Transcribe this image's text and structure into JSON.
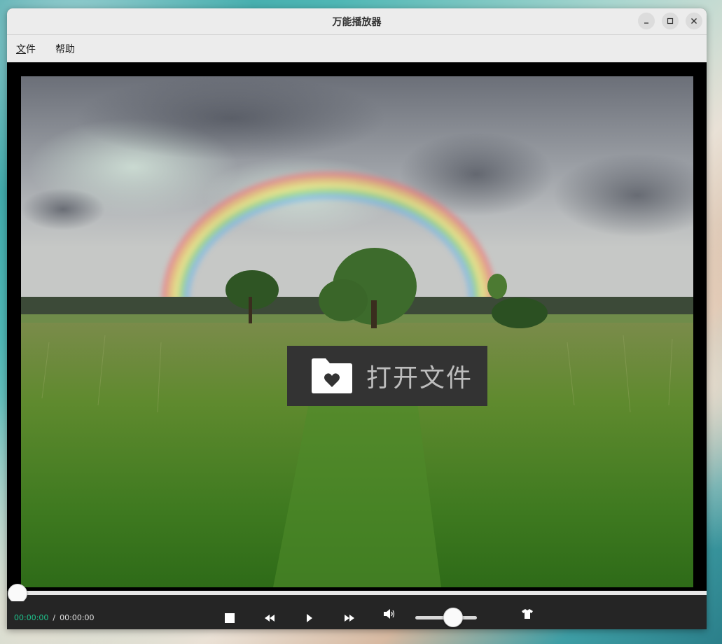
{
  "window": {
    "title": "万能播放器"
  },
  "menubar": {
    "items": [
      {
        "label": "文件",
        "mnemonic": "文"
      },
      {
        "label": "帮助"
      }
    ]
  },
  "video": {
    "open_file_label": "打开文件",
    "open_file_icon": "folder-heart-icon"
  },
  "playback": {
    "current_time": "00:00:00",
    "separator": "/",
    "total_time": "00:00:00",
    "progress": 0,
    "volume": 0.6
  },
  "controls": {
    "icons": [
      "stop-icon",
      "rewind-icon",
      "play-icon",
      "fast-forward-icon",
      "volume-icon",
      "skin-icon"
    ]
  },
  "colors": {
    "accent_time": "#1ec28b",
    "controls_bg": "#252525",
    "open_file_bg": "#333333"
  }
}
